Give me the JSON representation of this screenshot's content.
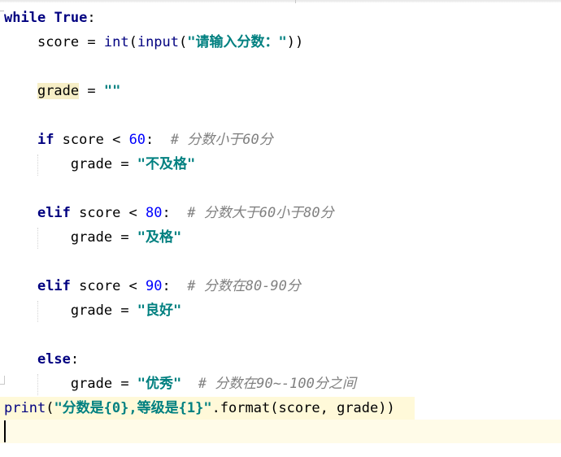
{
  "code": {
    "l1": {
      "kw": "while",
      "kw2": "True",
      "colon": ":"
    },
    "l2": {
      "var": "score",
      "eq": " = ",
      "fn1": "int",
      "p1": "(",
      "fn2": "input",
      "p2": "(",
      "str": "\"请输入分数：\"",
      "close": "))"
    },
    "l3": {
      "var": "grade",
      "eq": " = ",
      "str": "\"\""
    },
    "l4": {
      "kw": "if",
      "cond": " score < ",
      "num": "60",
      "colon": ":  ",
      "cmt": "# 分数小于60分"
    },
    "l5": {
      "var": "grade",
      "eq": " = ",
      "str": "\"不及格\""
    },
    "l6": {
      "kw": "elif",
      "cond": " score < ",
      "num": "80",
      "colon": ":  ",
      "cmt": "# 分数大于60小于80分"
    },
    "l7": {
      "var": "grade",
      "eq": " = ",
      "str": "\"及格\""
    },
    "l8": {
      "kw": "elif",
      "cond": " score < ",
      "num": "90",
      "colon": ":  ",
      "cmt": "# 分数在80-90分"
    },
    "l9": {
      "var": "grade",
      "eq": " = ",
      "str": "\"良好\""
    },
    "l10": {
      "kw": "else",
      "colon": ":"
    },
    "l11": {
      "var": "grade",
      "eq": " = ",
      "str": "\"优秀\"",
      "gap": "  ",
      "cmt": "# 分数在90~-100分之间"
    },
    "l12": {
      "fn": "print",
      "p1": "(",
      "str": "\"分数是{0},等级是{1}\"",
      "rest": ".format(score, grade))"
    }
  },
  "colors": {
    "keyword": "#000080",
    "number": "#0000ff",
    "string": "#008080",
    "comment": "#808080",
    "caret_line": "#fffbe8",
    "highlight": "#f6eec6"
  }
}
